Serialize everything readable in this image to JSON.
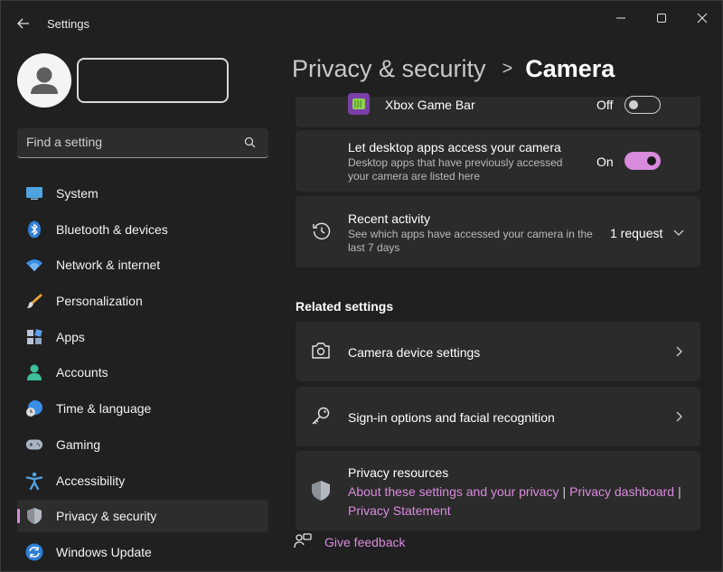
{
  "window": {
    "title": "Settings",
    "controls": [
      "minimize",
      "maximize",
      "close"
    ]
  },
  "search": {
    "placeholder": "Find a setting"
  },
  "sidebar": {
    "items": [
      {
        "label": "System",
        "icon": "monitor-icon"
      },
      {
        "label": "Bluetooth & devices",
        "icon": "bluetooth-icon"
      },
      {
        "label": "Network & internet",
        "icon": "wifi-icon"
      },
      {
        "label": "Personalization",
        "icon": "brush-icon"
      },
      {
        "label": "Apps",
        "icon": "apps-icon"
      },
      {
        "label": "Accounts",
        "icon": "person-icon"
      },
      {
        "label": "Time & language",
        "icon": "globe-clock-icon"
      },
      {
        "label": "Gaming",
        "icon": "gamepad-icon"
      },
      {
        "label": "Accessibility",
        "icon": "accessibility-icon"
      },
      {
        "label": "Privacy & security",
        "icon": "shield-icon",
        "active": true
      },
      {
        "label": "Windows Update",
        "icon": "update-icon"
      }
    ]
  },
  "breadcrumb": {
    "parent": "Privacy & security",
    "separator": ">",
    "current": "Camera"
  },
  "camera_settings": {
    "xbox": {
      "title": "Xbox Game Bar",
      "state": "Off",
      "enabled": false
    },
    "desktop_apps": {
      "title": "Let desktop apps access your camera",
      "desc_line1": "Desktop apps that have previously accessed",
      "desc_line2": "your camera are listed here",
      "state": "On",
      "enabled": true
    },
    "recent_activity": {
      "title": "Recent activity",
      "desc_line1": "See which apps have accessed your camera in the",
      "desc_line2": "last 7 days",
      "count": "1 request"
    }
  },
  "related": {
    "title": "Related settings",
    "camera_device": "Camera device settings",
    "signin": "Sign-in options and facial recognition",
    "privacy_resources": {
      "title": "Privacy resources",
      "link1": "About these settings and your privacy",
      "link2": "Privacy dashboard",
      "link3": "Privacy Statement",
      "separator": "|"
    }
  },
  "feedback": {
    "label": "Give feedback"
  },
  "colors": {
    "accent": "#d98bdc",
    "background": "#202020",
    "card": "#2b2b2b"
  }
}
